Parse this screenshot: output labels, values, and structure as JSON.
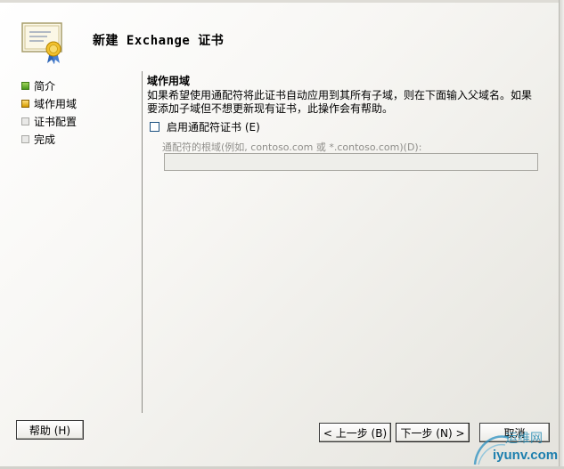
{
  "window": {
    "title": "新建 Exchange 证书"
  },
  "nav": {
    "items": [
      {
        "label": "简介",
        "state": "done"
      },
      {
        "label": "域作用域",
        "state": "current"
      },
      {
        "label": "证书配置",
        "state": "pending"
      },
      {
        "label": "完成",
        "state": "pending"
      }
    ]
  },
  "content": {
    "section_title": "域作用域",
    "description": "如果希望使用通配符将此证书自动应用到其所有子域，则在下面输入父域名。如果要添加子域但不想更新现有证书，此操作会有帮助。",
    "wildcard_checkbox": {
      "label": "启用通配符证书 (E)",
      "checked": false
    },
    "root_domain_field": {
      "label": "通配符的根域(例如, contoso.com 或 *.contoso.com)(D):",
      "value": "",
      "enabled": false
    }
  },
  "buttons": {
    "help": "帮助 (H)",
    "back": "< 上一步 (B)",
    "next": "下一步 (N) >",
    "cancel": "取消"
  },
  "watermark": {
    "brand": "运维网",
    "url": "iyunv.com"
  },
  "colors": {
    "done": "#4a9a1c",
    "current": "#d59a00",
    "pending": "#e9e9e7",
    "watermark": "#1d7fae"
  }
}
